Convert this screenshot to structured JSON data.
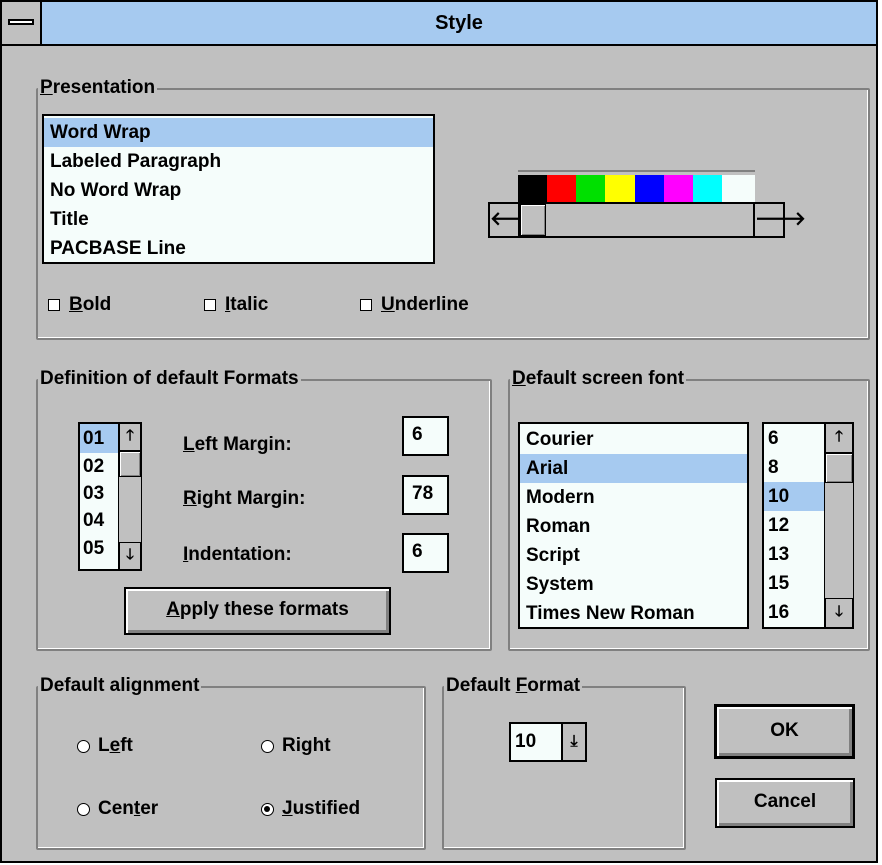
{
  "window": {
    "title": "Style"
  },
  "presentation": {
    "group_label_u": "P",
    "group_label_rest": "resentation",
    "items": [
      "Word Wrap",
      "Labeled Paragraph",
      "No Word Wrap",
      "Title",
      "PACBASE Line"
    ],
    "selected": "Word Wrap",
    "colors": [
      "#000000",
      "#ff0000",
      "#00e000",
      "#ffff00",
      "#0000ff",
      "#ff00ff",
      "#00ffff",
      "#f5fdfb"
    ],
    "bold": {
      "u": "B",
      "rest": "old",
      "checked": false
    },
    "italic": {
      "u": "I",
      "rest": "talic",
      "checked": false
    },
    "underline": {
      "u": "U",
      "rest": "nderline",
      "checked": false
    }
  },
  "formats": {
    "group_label": "Definition of default Formats",
    "list": [
      "01",
      "02",
      "03",
      "04",
      "05"
    ],
    "selected": "01",
    "left_margin": {
      "u": "L",
      "rest": "eft Margin:",
      "value": "6"
    },
    "right_margin": {
      "u": "R",
      "rest": "ight Margin:",
      "value": "78"
    },
    "indentation": {
      "u": "I",
      "rest": "ndentation:",
      "value": "6"
    },
    "apply_button": {
      "u": "A",
      "rest": "pply these formats"
    }
  },
  "screen_font": {
    "group_label_u": "D",
    "group_label_rest": "efault screen font",
    "fonts": [
      "Courier",
      "Arial",
      "Modern",
      "Roman",
      "Script",
      "System",
      "Times New Roman"
    ],
    "selected_font": "Arial",
    "sizes": [
      "6",
      "8",
      "10",
      "12",
      "13",
      "15",
      "16"
    ],
    "selected_size": "10"
  },
  "alignment": {
    "group_label": "Default alignment",
    "left": {
      "pre": "L",
      "u": "e",
      "rest": "ft",
      "checked": false
    },
    "right": {
      "pre": "Ri",
      "u": "g",
      "rest": "ht",
      "checked": false
    },
    "center": {
      "pre": "Cen",
      "u": "t",
      "rest": "er",
      "checked": false
    },
    "justified": {
      "pre": "",
      "u": "J",
      "rest": "ustified",
      "checked": true
    }
  },
  "default_format": {
    "group_label_pre": "Default ",
    "group_label_u": "F",
    "group_label_rest": "ormat",
    "value": "10"
  },
  "buttons": {
    "ok": "OK",
    "cancel": "Cancel"
  },
  "icons": {
    "left": "arrow-left-icon",
    "right": "arrow-right-icon",
    "up": "arrow-up-icon",
    "down": "arrow-down-icon",
    "dropdown": "dropdown-arrow-icon",
    "sysmenu": "system-menu-icon"
  }
}
